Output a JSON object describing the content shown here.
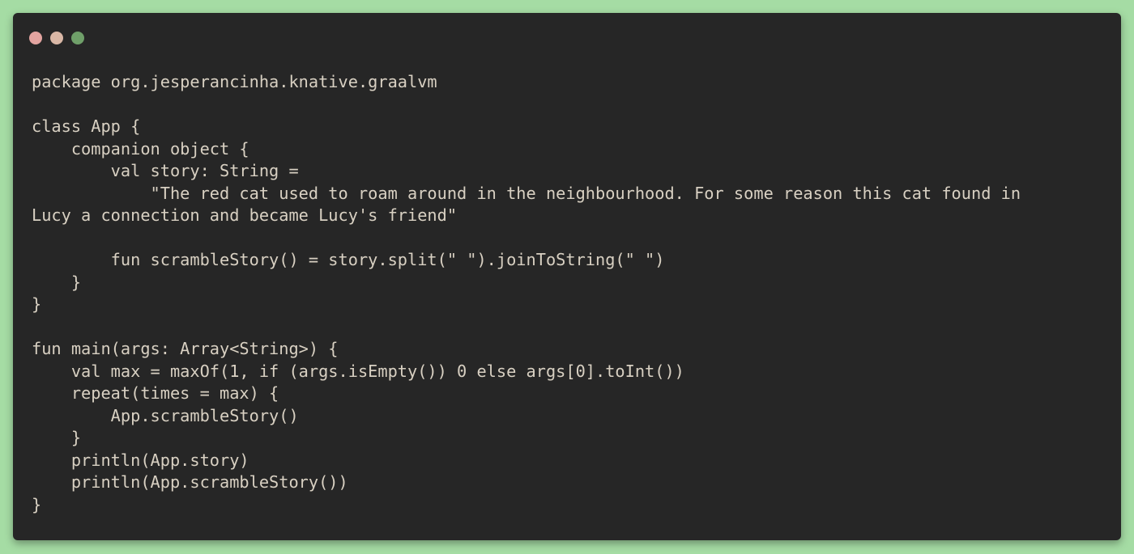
{
  "window": {
    "buttons": [
      {
        "name": "close-button",
        "color": "#e3a4a0"
      },
      {
        "name": "minimize-button",
        "color": "#d9b7a6"
      },
      {
        "name": "maximize-button",
        "color": "#6f9f69"
      }
    ]
  },
  "code": {
    "lines": [
      "package org.jesperancinha.knative.graalvm",
      "",
      "class App {",
      "    companion object {",
      "        val story: String =",
      "            \"The red cat used to roam around in the neighbourhood. For some reason this cat found in",
      "Lucy a connection and became Lucy's friend\"",
      "",
      "        fun scrambleStory() = story.split(\" \").joinToString(\" \")",
      "    }",
      "}",
      "",
      "fun main(args: Array<String>) {",
      "    val max = maxOf(1, if (args.isEmpty()) 0 else args[0].toInt())",
      "    repeat(times = max) {",
      "        App.scrambleStory()",
      "    }",
      "    println(App.story)",
      "    println(App.scrambleStory())",
      "}"
    ]
  },
  "colors": {
    "page_background": "#a5dca4",
    "editor_background": "#262626",
    "code_text": "#d8d0c2"
  }
}
